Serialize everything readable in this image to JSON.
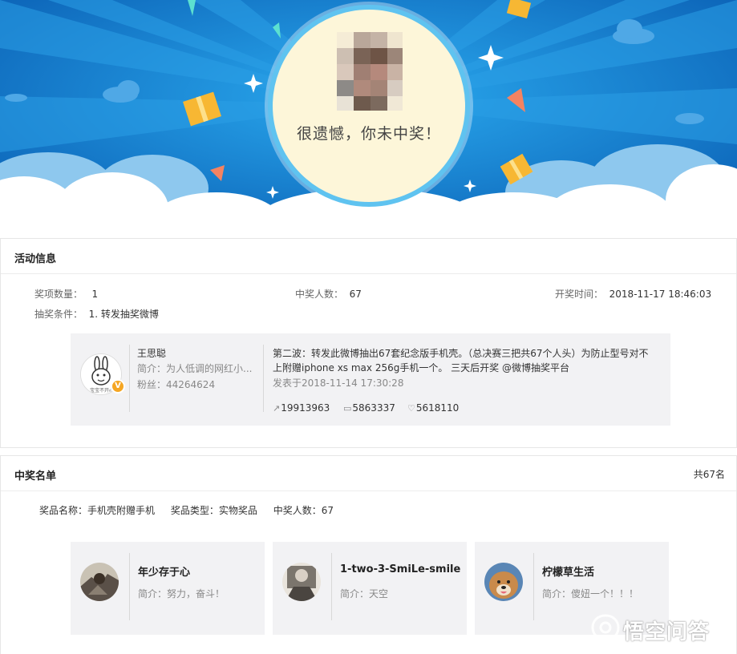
{
  "banner": {
    "result_text": "很遗憾，你未中奖！",
    "colors": {
      "sky_blue": "#0d6fc4",
      "cloud_white": "#ffffff",
      "circle_fill": "#fdf6d9",
      "gift": "#f7b733"
    }
  },
  "activity": {
    "title": "活动信息",
    "prize_count_label": "奖项数量：",
    "prize_count_value": "1",
    "winners_label": "中奖人数：",
    "winners_value": "67",
    "draw_time_label": "开奖时间：",
    "draw_time_value": "2018-11-17 18:46:03",
    "condition_label": "抽奖条件：",
    "condition_value": "1. 转发抽奖微博",
    "weibo": {
      "avatar_caption": "宝宝不开心",
      "author": "王思聪",
      "intro": "简介：为人低调的网红小...",
      "fans": "粉丝：44264624",
      "text": "第二波：转发此微博抽出67套纪念版手机壳。（总决赛三把共67个人头）为防止型号对不上附赠iphone xs max 256g手机一个。 三天后开奖 @微博抽奖平台",
      "posted": "发表于2018-11-14 17:30:28",
      "reposts": "19913963",
      "comments": "5863337",
      "likes": "5618110",
      "verified_badge": "V"
    }
  },
  "winners": {
    "title": "中奖名单",
    "total": "共67名",
    "prize_name": "奖品名称：手机壳附赠手机",
    "prize_type": "奖品类型：实物奖品",
    "prize_winners": "中奖人数：67",
    "list": [
      {
        "name": "年少存于心",
        "bio": "简介：努力，奋斗！"
      },
      {
        "name": "1-two-3-SmiLe-smile",
        "bio": "简介：天空"
      },
      {
        "name": "柠檬草生活",
        "bio": "简介：傻妞一个！！！"
      }
    ]
  },
  "watermark": {
    "text": "悟空问答"
  }
}
